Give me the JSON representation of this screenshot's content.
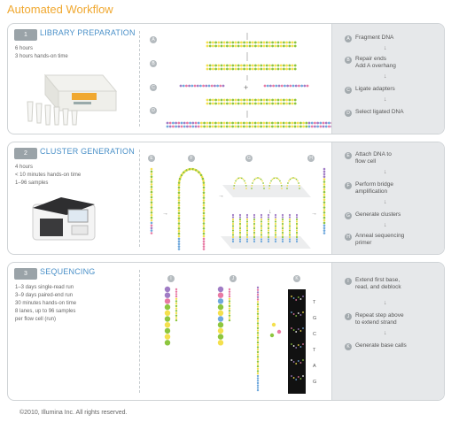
{
  "page_title": "Automated Workflow",
  "sections": [
    {
      "number": "1",
      "title": "LIBRARY PREPARATION",
      "info": [
        "6 hours",
        "3 hours hands-on time"
      ],
      "step_labels": [
        "A",
        "B",
        "C",
        "D"
      ],
      "steps": [
        {
          "letter": "A",
          "text": "Fragment DNA"
        },
        {
          "letter": "B",
          "text": "Repair ends\nAdd A overhang"
        },
        {
          "letter": "C",
          "text": "Ligate adapters"
        },
        {
          "letter": "D",
          "text": "Select ligated DNA"
        }
      ]
    },
    {
      "number": "2",
      "title": "CLUSTER GENERATION",
      "info": [
        "4 hours",
        "< 10 minutes hands-on time",
        "1–96 samples"
      ],
      "step_labels": [
        "E",
        "F",
        "G",
        "H"
      ],
      "steps": [
        {
          "letter": "E",
          "text": "Attach DNA to\nflow cell"
        },
        {
          "letter": "F",
          "text": "Perform bridge\namplification"
        },
        {
          "letter": "G",
          "text": "Generate clusters"
        },
        {
          "letter": "H",
          "text": "Anneal sequencing\nprimer"
        }
      ]
    },
    {
      "number": "3",
      "title": "SEQUENCING",
      "info": [
        "1–3 days single-read run",
        "3–9 days paired-end run",
        "30 minutes hands-on time",
        "8 lanes, up to 96 samples",
        "per flow cell (run)"
      ],
      "step_labels": [
        "I",
        "J",
        "K"
      ],
      "base_labels": [
        "T",
        "G",
        "C",
        "T",
        "A",
        "G"
      ],
      "steps": [
        {
          "letter": "I",
          "text": "Extend first base,\nread, and deblock"
        },
        {
          "letter": "J",
          "text": "Repeat step above\nto extend strand"
        },
        {
          "letter": "K",
          "text": "Generate base calls"
        }
      ]
    }
  ],
  "plus_sign": "+",
  "footer": "©2010, Illumina Inc. All rights reserved.",
  "colors": {
    "accent": "#f0a830",
    "section_title": "#4a90c8",
    "green": "#8dc63f",
    "yellow": "#f4e04d",
    "purple": "#a07cc5",
    "blue": "#6fa8dc",
    "pink": "#e87aa4"
  }
}
